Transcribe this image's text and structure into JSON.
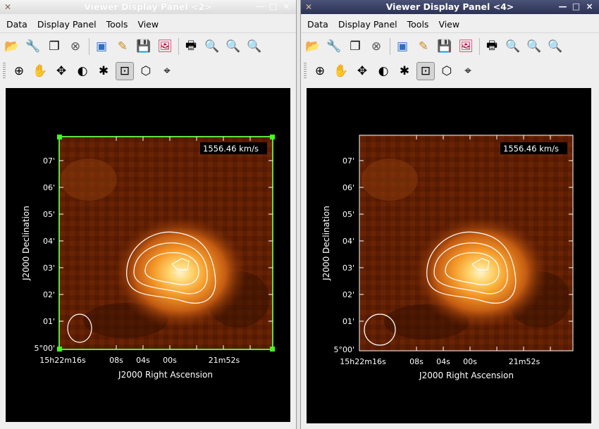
{
  "windows": [
    {
      "title": "Viewer Display Panel <2>",
      "menus": [
        "Data",
        "Display Panel",
        "Tools",
        "View"
      ],
      "velocity_label": "1556.46 km/s",
      "selected": true
    },
    {
      "title": "Viewer Display Panel <4>",
      "menus": [
        "Data",
        "Display Panel",
        "Tools",
        "View"
      ],
      "velocity_label": "1556.46 km/s",
      "selected": false
    }
  ],
  "window_buttons": {
    "minimize": "—",
    "maximize": "□",
    "close": "×"
  },
  "toolbar_main_icons": [
    "open-icon",
    "wrench-icon",
    "copy-icon",
    "close-circle-icon",
    "new-panel-icon",
    "preferences-icon",
    "save-icon",
    "export-image-icon",
    "print-icon",
    "zoom-fit-icon",
    "zoom-in-icon",
    "zoom-out-icon"
  ],
  "toolbar_tools_icons": [
    "zoom-tool-icon",
    "pan-tool-icon",
    "move-tool-icon",
    "contrast-tool-icon",
    "colormap-tool-icon",
    "rectangle-region-icon",
    "polygon-region-icon",
    "point-region-icon"
  ],
  "axes": {
    "y_label": "J2000 Declination",
    "x_label": "J2000 Right Ascension",
    "y_ticks": [
      "07'",
      "06'",
      "05'",
      "04'",
      "03'",
      "02'",
      "01'",
      "5°00'"
    ],
    "x_ticks": [
      "15h22m16s",
      "08s",
      "04s",
      "00s",
      "21m52s"
    ]
  },
  "colors": {
    "map_dark": "#3a1200",
    "contour": "#ffffff",
    "selection": "#60e040"
  }
}
